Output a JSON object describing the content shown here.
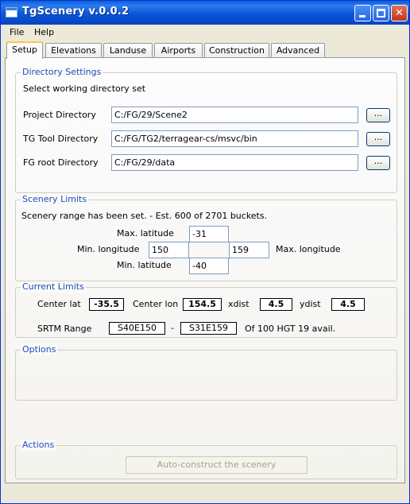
{
  "window": {
    "title": "TgScenery v.0.0.2"
  },
  "menu": [
    "File",
    "Help"
  ],
  "tabs": [
    "Setup",
    "Elevations",
    "Landuse",
    "Airports",
    "Construction",
    "Advanced"
  ],
  "directory": {
    "title": "Directory Settings",
    "subtitle": "Select working directory set",
    "project_label": "Project Directory",
    "project_value": "C:/FG/29/Scene2",
    "tgtool_label": "TG Tool Directory",
    "tgtool_value": "C:/FG/TG2/terragear-cs/msvc/bin",
    "fgroot_label": "FG root Directory",
    "fgroot_value": "C:/FG/29/data",
    "browse_label": "..."
  },
  "limits": {
    "title": "Scenery Limits",
    "status": "Scenery range has been set. - Est. 600 of 2701 buckets.",
    "max_lat_label": "Max. latitude",
    "max_lat_value": "-31",
    "min_lon_label": "Min. longitude",
    "min_lon_value": "150",
    "max_lon_value": "159",
    "max_lon_label": "Max. longitude",
    "min_lat_label": "Min. latitude",
    "min_lat_value": "-40"
  },
  "current": {
    "title": "Current Limits",
    "center_lat_label": "Center lat",
    "center_lat_value": "-35.5",
    "center_lon_label": "Center lon",
    "center_lon_value": "154.5",
    "xdist_label": "xdist",
    "xdist_value": "4.5",
    "ydist_label": "ydist",
    "ydist_value": "4.5",
    "srtm_label": "SRTM Range",
    "srtm_from": "S40E150",
    "srtm_sep": "-",
    "srtm_to": "S31E159",
    "srtm_note": "Of 100 HGT 19 avail."
  },
  "options": {
    "title": "Options"
  },
  "actions": {
    "title": "Actions",
    "button": "Auto-construct the scenery"
  }
}
